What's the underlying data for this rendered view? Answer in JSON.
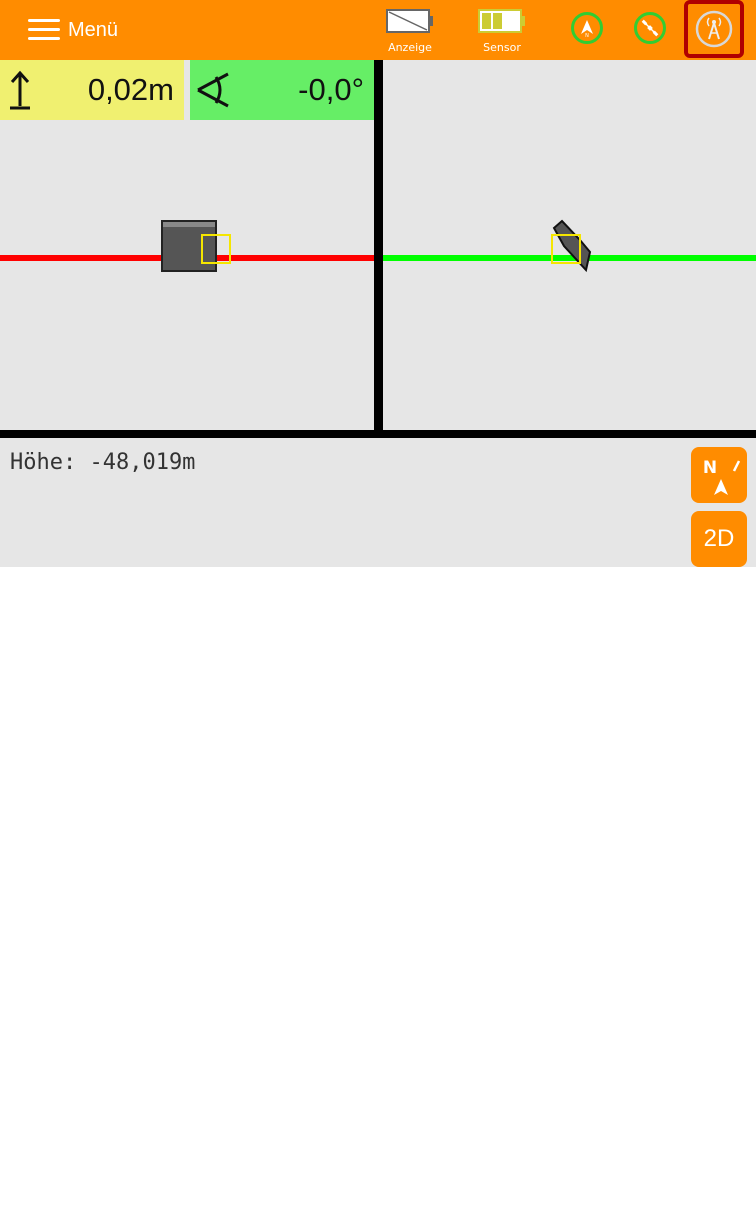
{
  "topbar": {
    "menu_label": "Menü",
    "display_battery_label": "Anzeige",
    "sensor_battery_label": "Sensor",
    "display_battery_level": 0.0,
    "sensor_battery_level": 0.5,
    "status_north_icon": "north-arrow-icon",
    "status_satellite_icon": "satellite-icon",
    "antenna_icon": "antenna-icon"
  },
  "readouts": {
    "height_value": "0,02m",
    "angle_value": "-0,0°"
  },
  "bottom": {
    "hoehe_label": "Höhe: -48,019m",
    "mode_button": "2D"
  },
  "colors": {
    "topbar": "#ff8c00",
    "height_box": "#f0f070",
    "angle_box": "#66ee66",
    "ref_line_left": "#ff0000",
    "ref_line_right": "#00ff00",
    "highlight_border": "#b00000",
    "status_ring": "#32cd32"
  }
}
